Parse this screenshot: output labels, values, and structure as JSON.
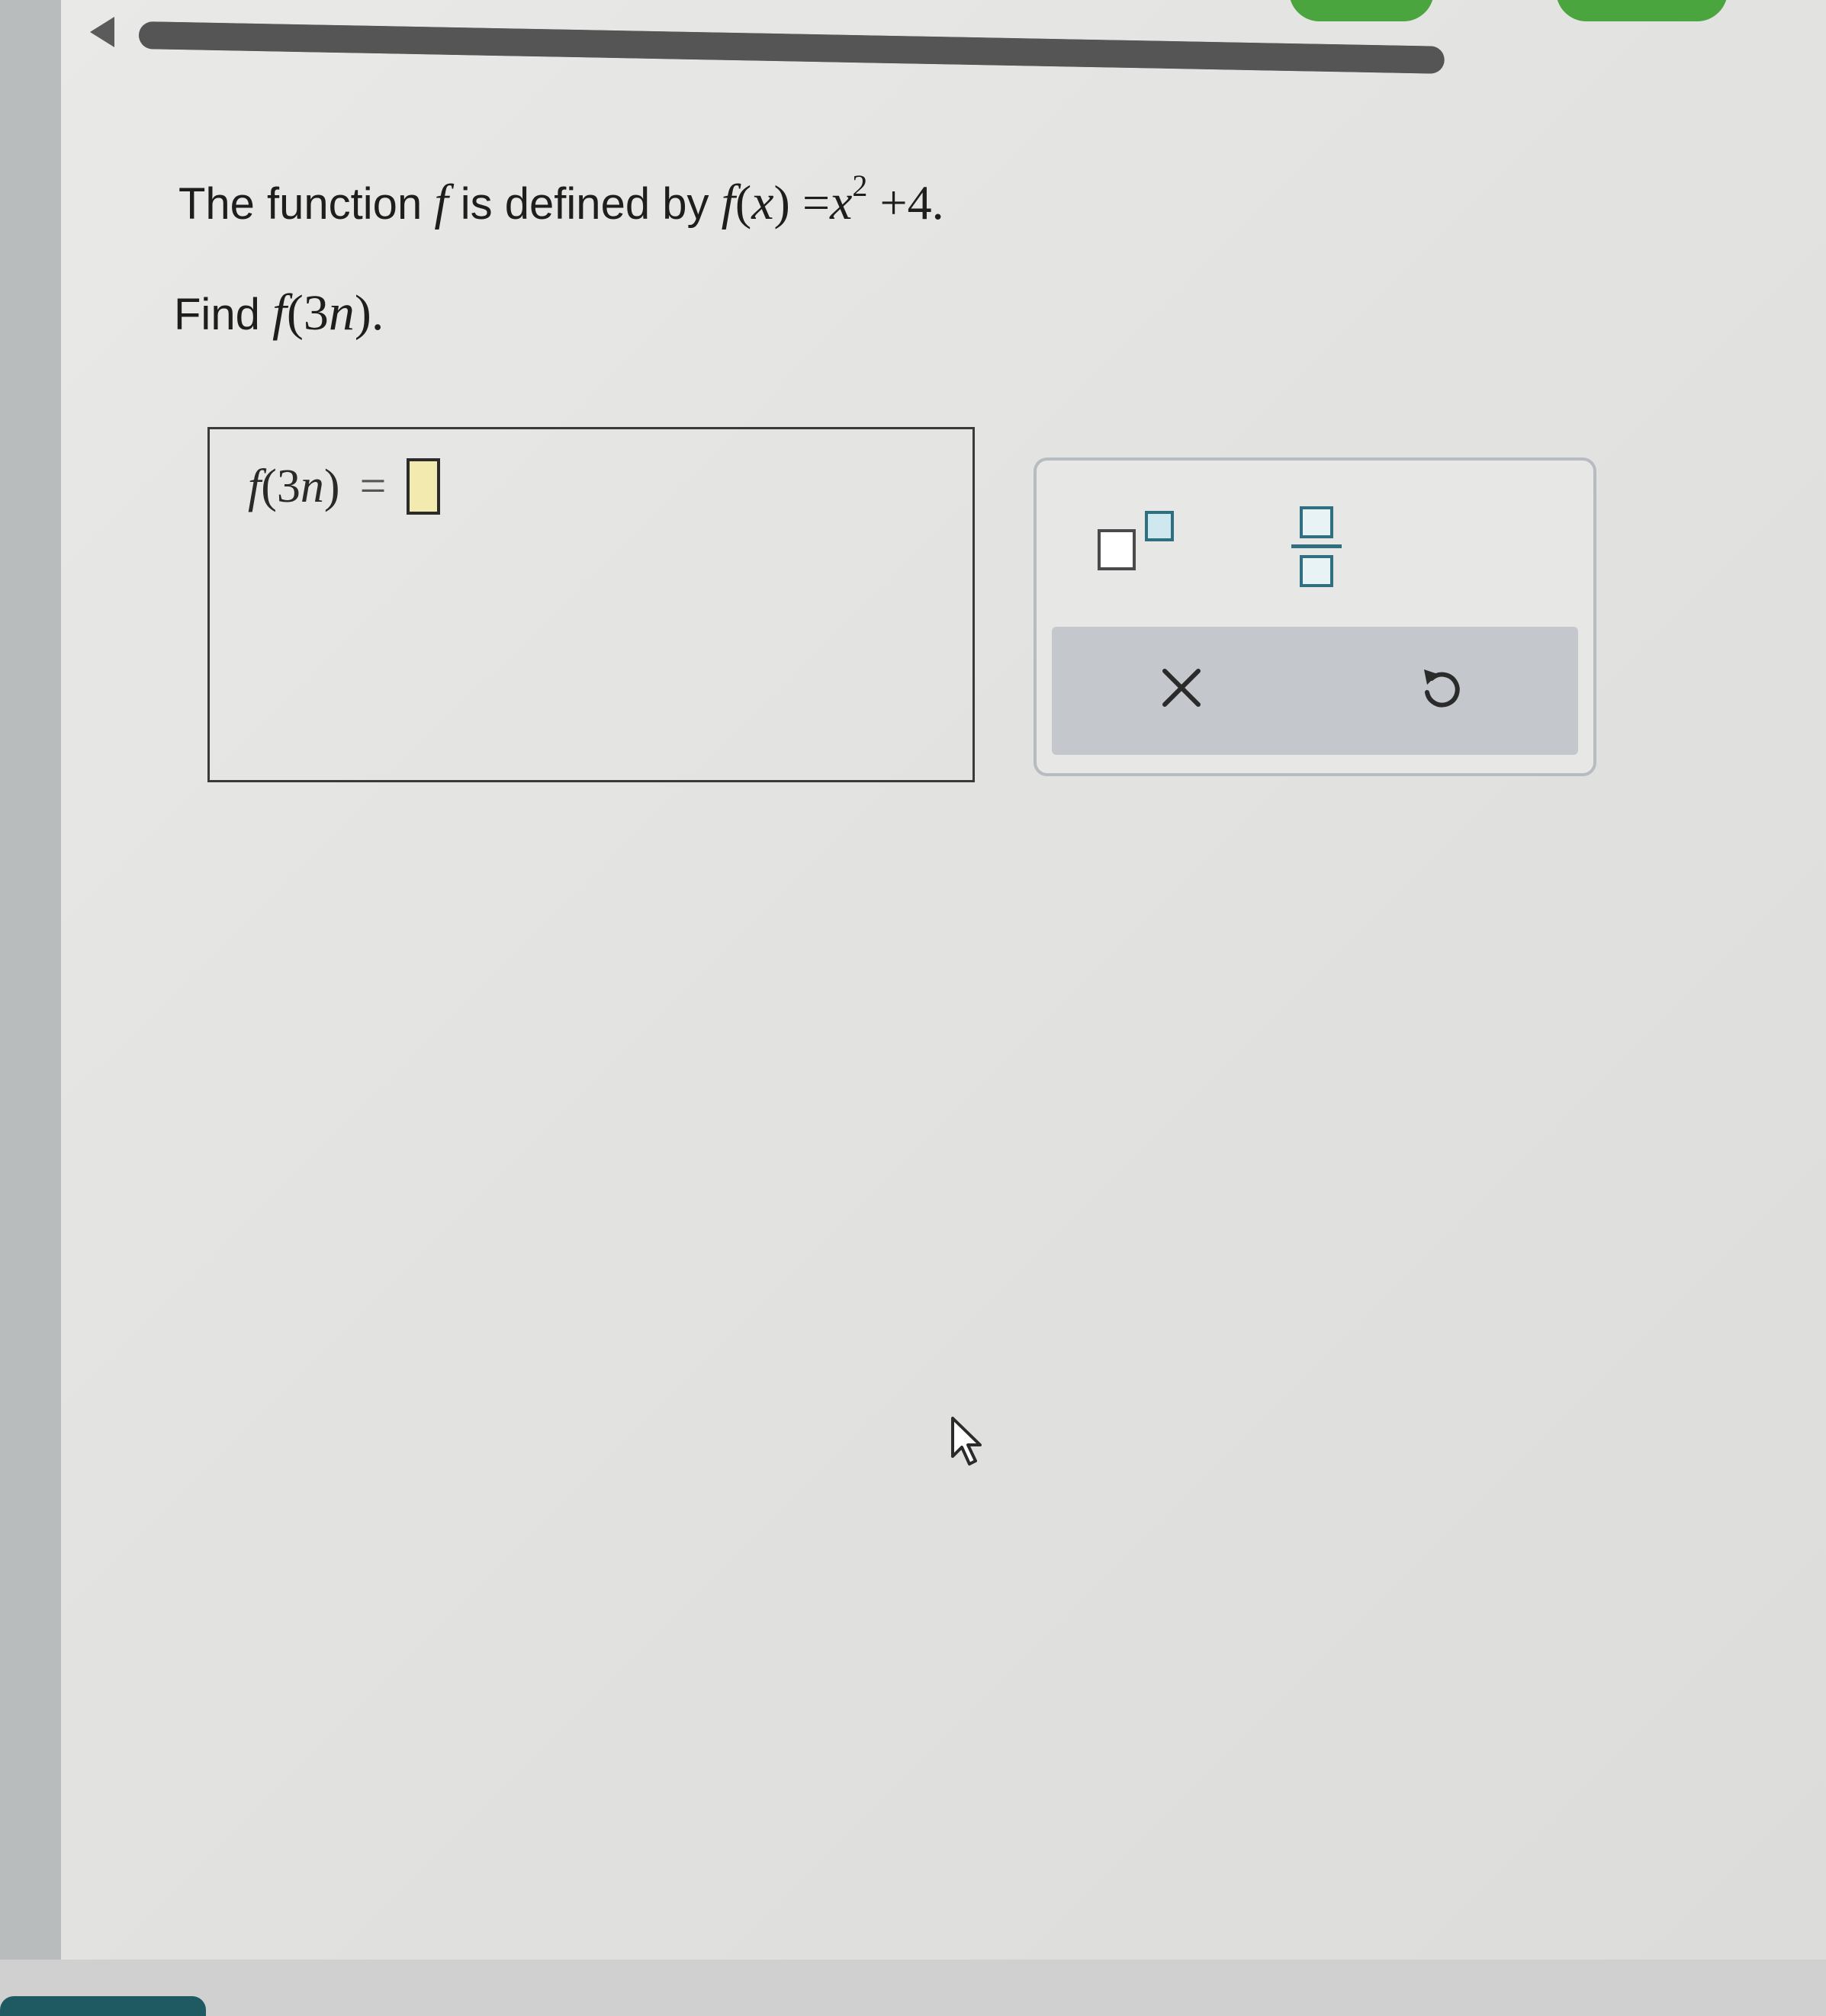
{
  "question": {
    "intro": "The function",
    "func": "f",
    "mid": "is defined by",
    "lhs": "f",
    "lhs_paren_open": "(",
    "lhs_var": "x",
    "lhs_paren_close": ")",
    "equals": "=",
    "rhs_var": "x",
    "rhs_exp": "2",
    "rhs_rest": "+4."
  },
  "find": {
    "label": "Find",
    "func": "f",
    "paren_open": "(3",
    "var": "n",
    "paren_close": ")."
  },
  "answer": {
    "func": "f",
    "paren_open": "(3",
    "var": "n",
    "paren_close": ")",
    "equals": "=",
    "value": ""
  },
  "keypad": {
    "keys": [
      "superscript-key",
      "fraction-key",
      "clear-key",
      "undo-key"
    ]
  },
  "icons": {
    "back": "caret-left-icon",
    "clear": "x-icon",
    "undo": "undo-icon",
    "pointer": "mouse-pointer-icon"
  },
  "colors": {
    "accent_teal": "#2f6f7f",
    "green": "#4aa53f",
    "slot_fill": "#f3eab0"
  }
}
